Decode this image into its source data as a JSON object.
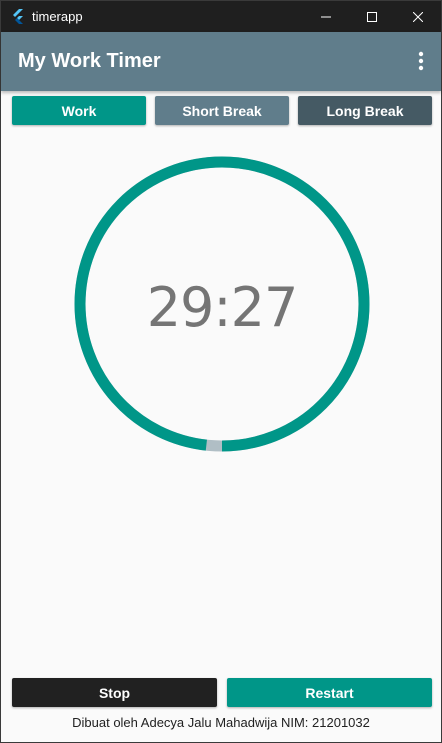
{
  "window": {
    "title": "timerapp",
    "app_icon": "flutter-logo-icon",
    "controls": [
      "minimize-icon",
      "maximize-icon",
      "close-icon"
    ]
  },
  "appbar": {
    "title": "My Work Timer",
    "menu_icon": "more-vert-icon"
  },
  "tabs": [
    {
      "label": "Work",
      "color": "#009688"
    },
    {
      "label": "Short Break",
      "color": "#607D8B"
    },
    {
      "label": "Long Break",
      "color": "#455A64"
    }
  ],
  "timer": {
    "time": "29:27",
    "progress": 0.982,
    "progress_color": "#009688",
    "track_color": "#B0BEC5"
  },
  "actions": {
    "stop_label": "Stop",
    "stop_color": "#212121",
    "restart_label": "Restart",
    "restart_color": "#009688"
  },
  "footer": {
    "text": "Dibuat oleh Adecya Jalu Mahadwija NIM: 21201032"
  }
}
